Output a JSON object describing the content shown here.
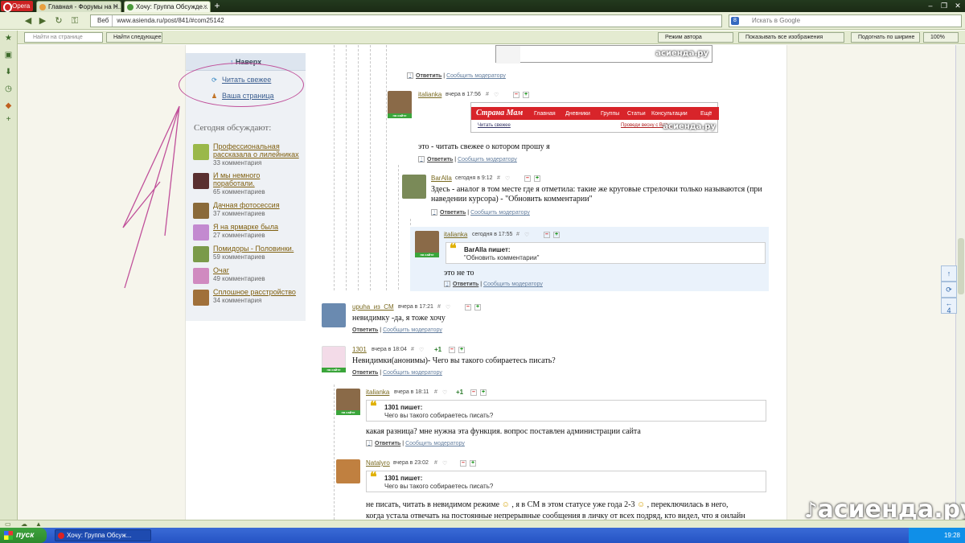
{
  "browser": {
    "menu_label": "Opera",
    "tabs": [
      {
        "title": "Главная - Форумы на Н..."
      },
      {
        "title": "Хочу: Группа Обсужде..."
      }
    ],
    "address": {
      "web_label": "Веб",
      "url": "www.asienda.ru/post/841/#com25142"
    },
    "search_placeholder": "Искать в Google",
    "find": {
      "placeholder": "Найти на странице",
      "next_label": "Найти следующее",
      "author_mode": "Режим автора",
      "show_images": "Показывать все изображения",
      "fit_width": "Подогнать по ширине",
      "zoom": "100%"
    }
  },
  "sidebar": {
    "top_label": "Наверх",
    "fresh_label": "Читать свежее",
    "your_page_label": "Ваша страница",
    "discuss_title": "Сегодня обсуждают:",
    "items": [
      {
        "title": "Профессиональная рассказала о лилейниках",
        "comments": "33 комментария",
        "color": "#7a9a2a"
      },
      {
        "title": "И мы немного поработали.",
        "comments": "65 комментариев",
        "color": "#6a3a3a"
      },
      {
        "title": "Дачная фотосессия",
        "comments": "37 комментариев",
        "color": "#7a5a2a"
      },
      {
        "title": "Я на ярмарке была",
        "comments": "27 комментариев",
        "color": "#b77ac4"
      },
      {
        "title": "Помидоры - Половинки.",
        "comments": "59 комментариев",
        "color": "#6a8a3a"
      },
      {
        "title": "Очаг",
        "comments": "49 комментариев",
        "color": "#c47ab0"
      },
      {
        "title": "Сплошное расстройство",
        "comments": "34 комментария",
        "color": "#8a5a2a"
      }
    ]
  },
  "comments": {
    "reply_label": "Ответить",
    "report_label": "Сообщить модератору",
    "online_label": "на сайте",
    "writes_suffix": "пишет:",
    "c1": {
      "user": "italianka",
      "time": "вчера в 17:56",
      "text": "это - читать свежее о котором прошу я"
    },
    "c2": {
      "user": "BarAlla",
      "time": "сегодня в 9:12",
      "text": "Здесь - аналог в том месте где я отметила: такие же круговые стрелочки только называются (при наведении курсора) - \"Обновить комментарии\""
    },
    "c3": {
      "user": "italianka",
      "time": "сегодня в 17:55",
      "quote_author": "BarAlla",
      "quote_text": "\"Обновить комментарии\"",
      "text": "это не то"
    },
    "c4": {
      "user": "upuha_из_СМ",
      "time": "вчера в 17:21",
      "text": "невидимку -да, я тоже хочу"
    },
    "c5": {
      "user": "1301",
      "time": "вчера в 18:04",
      "score": "+1",
      "text": "Невидимки(анонимы)- Чего вы такого собираетесь писать?"
    },
    "c6": {
      "user": "italianka",
      "time": "вчера в 18:11",
      "score": "+1",
      "quote_author": "1301",
      "quote_text": "Чего вы такого собираетесь писать?",
      "text": "какая разница? мне нужна эта функция. вопрос поставлен администрации сайта"
    },
    "c7": {
      "user": "Natalyro",
      "time": "вчера в 23:02",
      "quote_author": "1301",
      "quote_text": "Чего вы такого собираетесь писать?",
      "text1": "не писать, читать в невидимом режиме",
      "text2": ", я в СМ в этом статусе уже года 2-3",
      "text3": ", переключилась в него,",
      "text4": "когда устала отвечать на постоянные непрерывные сообщения в личку от всех подряд, кто видел, что я онлайн"
    }
  },
  "screenshot": {
    "brand": "Страна Мам",
    "menu": [
      "Главная",
      "Дневники",
      "Группы",
      "Статьи",
      "Консультации",
      "Ещё"
    ],
    "fresh_link": "Читать свежее",
    "promo": "Проведи весну с Вас..."
  },
  "watermark": "асиенда.ру",
  "rtools_count": "4",
  "taskbar": {
    "start": "пуск",
    "task": "Хочу: Группа Обсуж...",
    "clock": "19:28"
  }
}
